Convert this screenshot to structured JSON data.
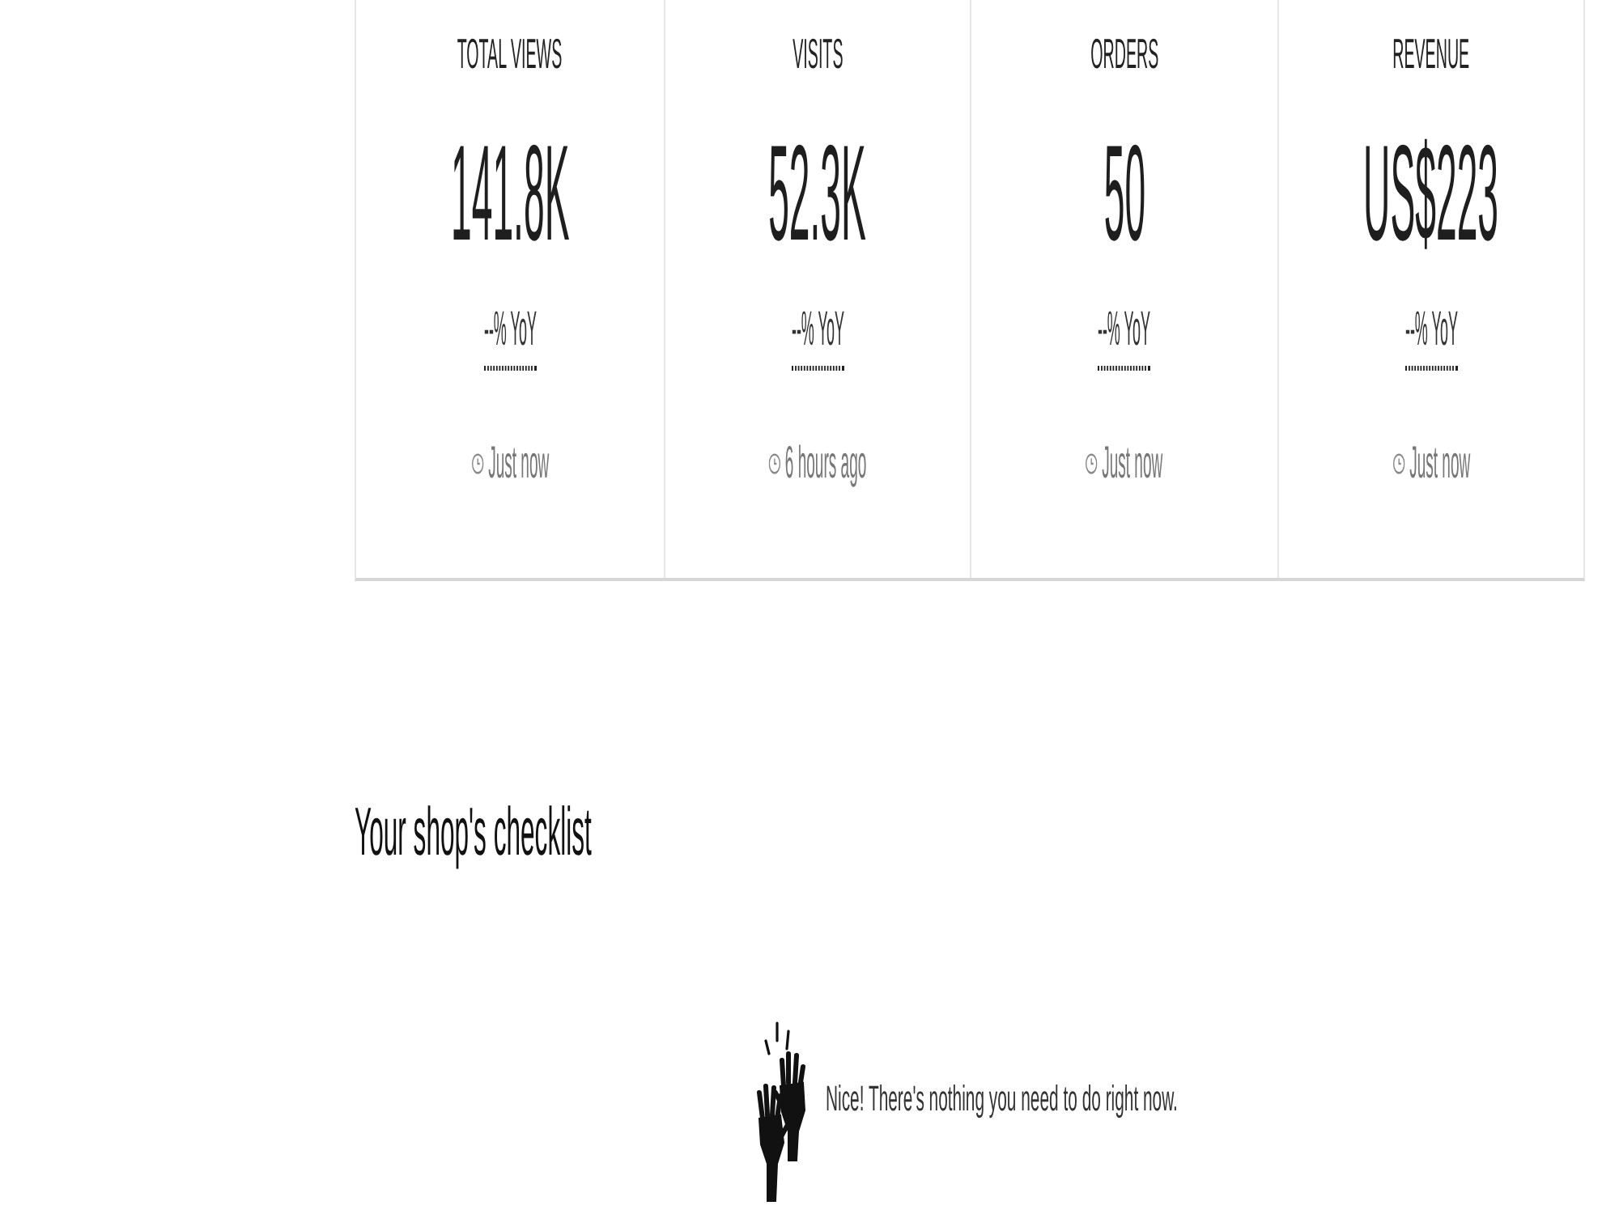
{
  "stats_card": {
    "metrics": [
      {
        "label": "TOTAL VIEWS",
        "value": "141.8K",
        "change": "--% YoY",
        "updated": "Just now"
      },
      {
        "label": "VISITS",
        "value": "52.3K",
        "change": "--% YoY",
        "updated": "6 hours ago"
      },
      {
        "label": "ORDERS",
        "value": "50",
        "change": "--% YoY",
        "updated": "Just now"
      },
      {
        "label": "REVENUE",
        "value": "US$223",
        "change": "--% YoY",
        "updated": "Just now"
      }
    ]
  },
  "checklist": {
    "title": "Your shop's checklist",
    "empty_message": "Nice! There's nothing you need to do right now."
  }
}
